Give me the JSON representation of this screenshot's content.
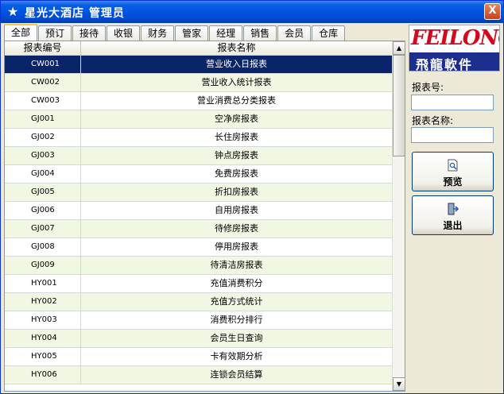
{
  "window": {
    "title": "星光大酒店 管理员",
    "close_label": "X"
  },
  "tabs": [
    "全部",
    "预订",
    "接待",
    "收银",
    "财务",
    "管家",
    "经理",
    "销售",
    "会员",
    "仓库"
  ],
  "grid": {
    "columns": [
      "报表编号",
      "报表名称"
    ],
    "rows": [
      [
        "CW001",
        "营业收入日报表"
      ],
      [
        "CW002",
        "营业收入统计报表"
      ],
      [
        "CW003",
        "营业消费总分类报表"
      ],
      [
        "GJ001",
        "空净房报表"
      ],
      [
        "GJ002",
        "长住房报表"
      ],
      [
        "GJ003",
        "钟点房报表"
      ],
      [
        "GJ004",
        "免费房报表"
      ],
      [
        "GJ005",
        "折扣房报表"
      ],
      [
        "GJ006",
        "自用房报表"
      ],
      [
        "GJ007",
        "待修房报表"
      ],
      [
        "GJ008",
        "停用房报表"
      ],
      [
        "GJ009",
        "待清洁房报表"
      ],
      [
        "HY001",
        "充值消费积分"
      ],
      [
        "HY002",
        "充值方式统计"
      ],
      [
        "HY003",
        "消费积分排行"
      ],
      [
        "HY004",
        "会员生日查询"
      ],
      [
        "HY005",
        "卡有效期分析"
      ],
      [
        "HY006",
        "连锁会员结算"
      ]
    ]
  },
  "logo": {
    "top_text": "FEILONG",
    "bottom_text": "飛龍軟件"
  },
  "side": {
    "report_no_label": "报表号:",
    "report_no_value": "",
    "report_name_label": "报表名称:",
    "report_name_value": "",
    "preview_label": "预览",
    "exit_label": "退出"
  },
  "colors": {
    "selected_row": "#0a246a",
    "alt_row": "#f0f7e2",
    "title_bar": "#0054e3"
  }
}
